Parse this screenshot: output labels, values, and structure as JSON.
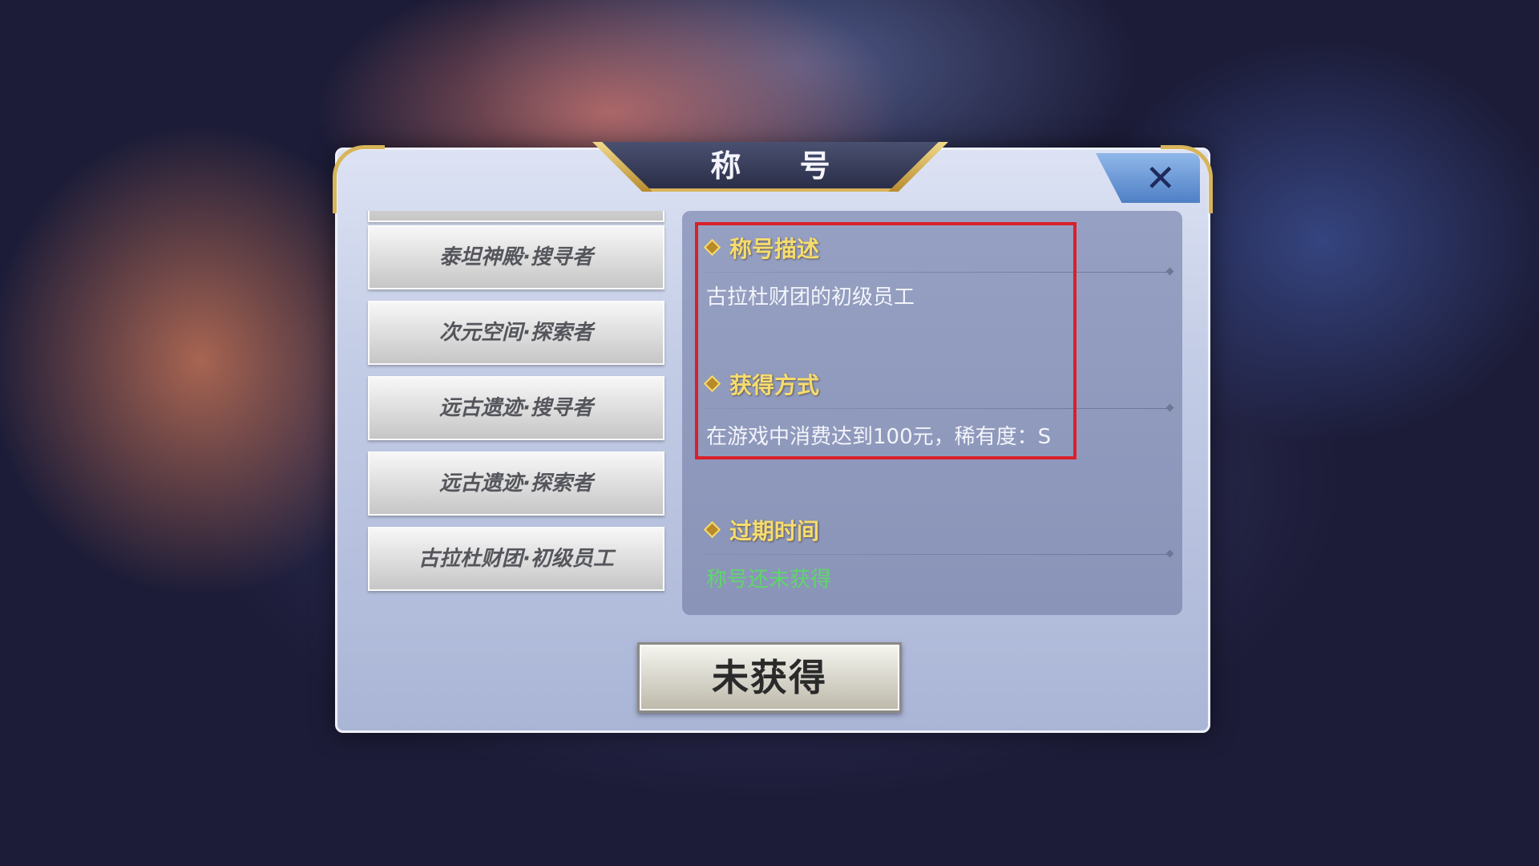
{
  "dialog": {
    "title": "称 号",
    "close_glyph": "✕"
  },
  "title_list": {
    "items": [
      {
        "label": ""
      },
      {
        "label": "泰坦神殿·搜寻者"
      },
      {
        "label": "次元空间·探索者"
      },
      {
        "label": "远古遗迹·搜寻者"
      },
      {
        "label": "远古遗迹·探索者"
      },
      {
        "label": "古拉杜财团·初级员工"
      }
    ]
  },
  "detail": {
    "description": {
      "heading": "称号描述",
      "text": "古拉杜财团的初级员工"
    },
    "acquisition": {
      "heading": "获得方式",
      "text": "在游戏中消费达到100元，稀有度：S"
    },
    "expiry": {
      "heading": "过期时间",
      "text": "称号还未获得"
    }
  },
  "action_button": {
    "label": "未获得"
  },
  "colors": {
    "heading_gold": "#f6dc6e",
    "status_green": "#5fd66a",
    "highlight_red": "#d9202a",
    "gold_trim": "#d8b45a"
  }
}
